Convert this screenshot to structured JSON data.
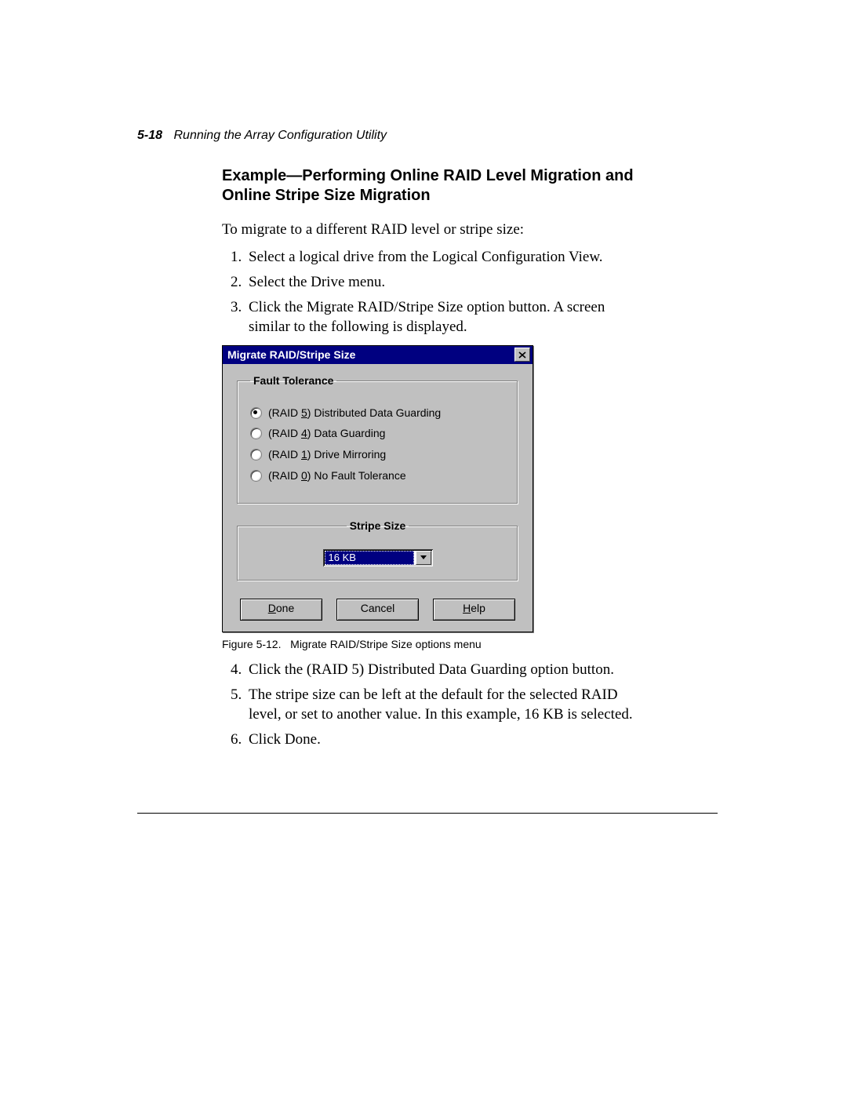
{
  "header": {
    "page_number": "5-18",
    "running_title": "Running the Array Configuration Utility"
  },
  "section": {
    "title": "Example—Performing Online RAID Level Migration and Online Stripe Size Migration",
    "intro": "To migrate to a different RAID level or stripe size:",
    "steps_a": [
      "Select a logical drive from the Logical Configuration View.",
      "Select the Drive menu.",
      "Click the Migrate RAID/Stripe Size option button. A screen similar to the following is displayed."
    ],
    "steps_b": [
      "Click the (RAID 5) Distributed Data Guarding option button.",
      "The stripe size can be left at the default for the selected RAID level, or set to another value. In this example, 16 KB is selected.",
      "Click Done."
    ]
  },
  "figure": {
    "caption_label": "Figure 5-12.",
    "caption_text": "Migrate RAID/Stripe Size options menu"
  },
  "dialog": {
    "title": "Migrate RAID/Stripe Size",
    "groups": {
      "fault_tolerance": {
        "legend": "Fault Tolerance",
        "options": [
          {
            "mnemonic": "5",
            "prefix": "(RAID ",
            "suffix": ") Distributed Data Guarding",
            "selected": true
          },
          {
            "mnemonic": "4",
            "prefix": "(RAID ",
            "suffix": ") Data Guarding",
            "selected": false
          },
          {
            "mnemonic": "1",
            "prefix": "(RAID ",
            "suffix": ") Drive Mirroring",
            "selected": false
          },
          {
            "mnemonic": "0",
            "prefix": "(RAID ",
            "suffix": ") No Fault Tolerance",
            "selected": false
          }
        ]
      },
      "stripe_size": {
        "legend": "Stripe Size",
        "value": "16 KB"
      }
    },
    "buttons": {
      "done": {
        "mnemonic": "D",
        "rest": "one"
      },
      "cancel": {
        "label": "Cancel"
      },
      "help": {
        "mnemonic": "H",
        "rest": "elp"
      }
    }
  }
}
